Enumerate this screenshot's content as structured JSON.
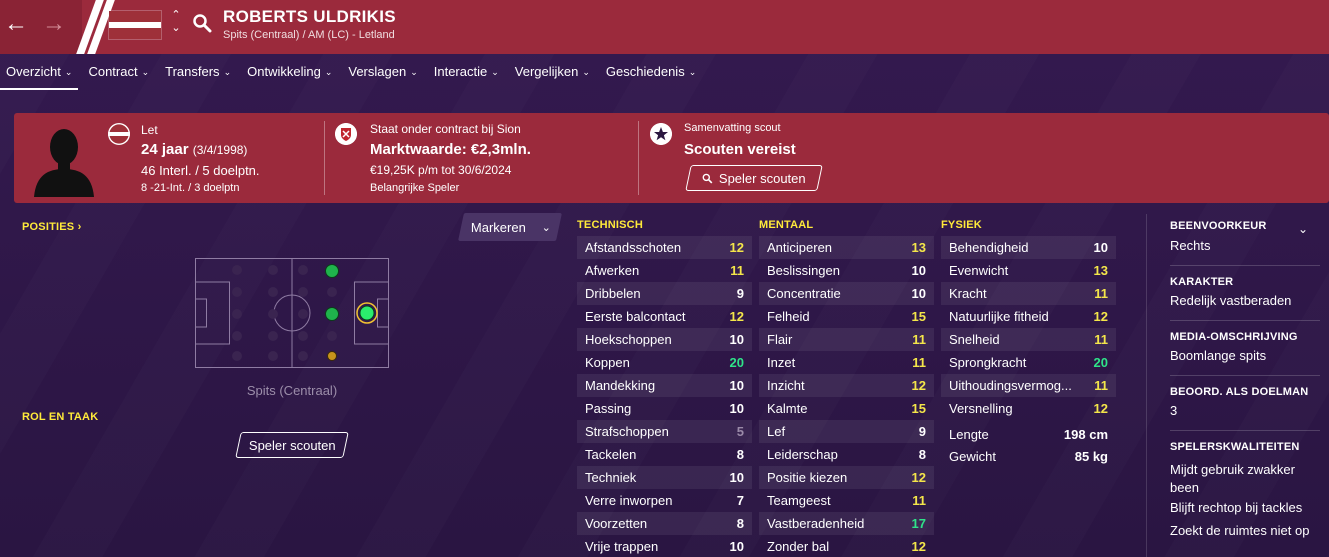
{
  "header": {
    "name": "ROBERTS ULDRIKIS",
    "subtitle": "Spits (Centraal) / AM (LC) - Letland",
    "accent": "#9b2a3c"
  },
  "tabs": [
    {
      "label": "Overzicht",
      "active": true
    },
    {
      "label": "Contract"
    },
    {
      "label": "Transfers"
    },
    {
      "label": "Ontwikkeling"
    },
    {
      "label": "Verslagen"
    },
    {
      "label": "Interactie"
    },
    {
      "label": "Vergelijken"
    },
    {
      "label": "Geschiedenis"
    }
  ],
  "info": {
    "nationality": "Let",
    "age": "24 jaar",
    "dob": "(3/4/1998)",
    "caps": "46 Interl. / 5 doelptn.",
    "u21": "8 -21-Int. / 3 doelptn",
    "contract_title": "Staat onder contract bij Sion",
    "market_value": "Marktwaarde: €2,3mln.",
    "wage": "€19,25K p/m tot 30/6/2024",
    "role_status": "Belangrijke Speler",
    "scout_title": "Samenvatting scout",
    "scout_status": "Scouten vereist",
    "scout_button": "Speler scouten"
  },
  "left": {
    "positions_title": "POSITIES",
    "marker_label": "Markeren",
    "position_label": "Spits (Centraal)",
    "role_title": "ROL EN TAAK",
    "scout_button": "Speler scouten"
  },
  "attributes": {
    "technical_title": "TECHNISCH",
    "mental_title": "MENTAAL",
    "physical_title": "FYSIEK",
    "technical": [
      {
        "name": "Afstandsschoten",
        "value": "12"
      },
      {
        "name": "Afwerken",
        "value": "11"
      },
      {
        "name": "Dribbelen",
        "value": "9"
      },
      {
        "name": "Eerste balcontact",
        "value": "12"
      },
      {
        "name": "Hoekschoppen",
        "value": "10"
      },
      {
        "name": "Koppen",
        "value": "20"
      },
      {
        "name": "Mandekking",
        "value": "10"
      },
      {
        "name": "Passing",
        "value": "10"
      },
      {
        "name": "Strafschoppen",
        "value": "5"
      },
      {
        "name": "Tackelen",
        "value": "8"
      },
      {
        "name": "Techniek",
        "value": "10"
      },
      {
        "name": "Verre inworpen",
        "value": "7"
      },
      {
        "name": "Voorzetten",
        "value": "8"
      },
      {
        "name": "Vrije trappen",
        "value": "10"
      }
    ],
    "mental": [
      {
        "name": "Anticiperen",
        "value": "13"
      },
      {
        "name": "Beslissingen",
        "value": "10"
      },
      {
        "name": "Concentratie",
        "value": "10"
      },
      {
        "name": "Felheid",
        "value": "15"
      },
      {
        "name": "Flair",
        "value": "11"
      },
      {
        "name": "Inzet",
        "value": "11"
      },
      {
        "name": "Inzicht",
        "value": "12"
      },
      {
        "name": "Kalmte",
        "value": "15"
      },
      {
        "name": "Lef",
        "value": "9"
      },
      {
        "name": "Leiderschap",
        "value": "8"
      },
      {
        "name": "Positie kiezen",
        "value": "12"
      },
      {
        "name": "Teamgeest",
        "value": "11"
      },
      {
        "name": "Vastberadenheid",
        "value": "17"
      },
      {
        "name": "Zonder bal",
        "value": "12"
      }
    ],
    "physical": [
      {
        "name": "Behendigheid",
        "value": "10"
      },
      {
        "name": "Evenwicht",
        "value": "13"
      },
      {
        "name": "Kracht",
        "value": "11"
      },
      {
        "name": "Natuurlijke fitheid",
        "value": "12"
      },
      {
        "name": "Snelheid",
        "value": "11"
      },
      {
        "name": "Sprongkracht",
        "value": "20"
      },
      {
        "name": "Uithoudingsvermog...",
        "value": "11"
      },
      {
        "name": "Versnelling",
        "value": "12"
      }
    ],
    "height_label": "Lengte",
    "height_value": "198 cm",
    "weight_label": "Gewicht",
    "weight_value": "85 kg"
  },
  "right": {
    "foot_title": "BEENVOORKEUR",
    "foot_value": "Rechts",
    "character_title": "KARAKTER",
    "character_value": "Redelijk vastberaden",
    "media_title": "MEDIA-OMSCHRIJVING",
    "media_value": "Boomlange spits",
    "gk_title": "BEOORD. ALS DOELMAN",
    "gk_value": "3",
    "qualities_title": "SPELERSKWALITEITEN",
    "qualities": [
      "Mijdt gebruik zwakker been",
      "Blijft rechtop bij tackles",
      "Zoekt de ruimtes niet op"
    ]
  }
}
